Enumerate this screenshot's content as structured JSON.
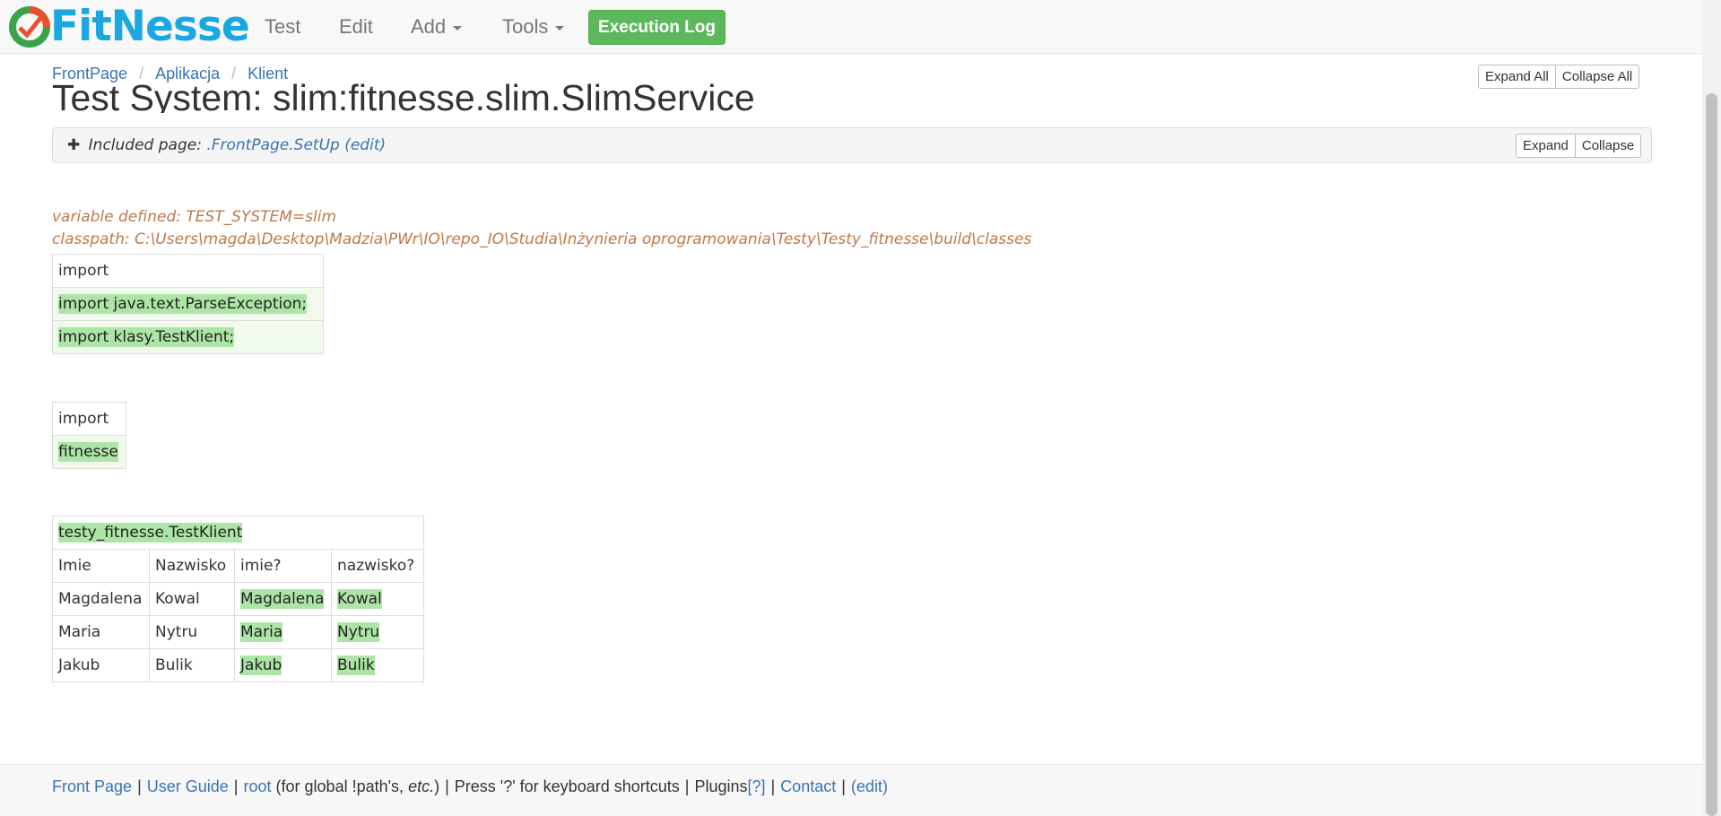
{
  "brand": {
    "name": "FitNesse",
    "color": "#1ba7e0"
  },
  "nav": {
    "test": "Test",
    "edit": "Edit",
    "add": "Add",
    "tools": "Tools",
    "execution_log": "Execution Log"
  },
  "breadcrumb": [
    "FrontPage",
    "Aplikacja",
    "Klient"
  ],
  "title": "Test System: slim:fitnesse.slim.SlimService",
  "page_buttons": {
    "expand_all": "Expand All",
    "collapse_all": "Collapse All"
  },
  "included": {
    "label": "Included page:",
    "page": ".FrontPage.SetUp",
    "edit": "(edit)",
    "expand": "Expand",
    "collapse": "Collapse"
  },
  "variable_defined": "variable defined: TEST_SYSTEM=slim",
  "classpath": "classpath: C:\\Users\\magda\\Desktop\\Madzia\\PWr\\IO\\repo_IO\\Studia\\Inżynieria oprogramowania\\Testy\\Testy_fitnesse\\build\\classes",
  "import_table_1": {
    "header": "import",
    "rows": [
      "import java.text.ParseException;",
      "import klasy.TestKlient;"
    ]
  },
  "import_table_2": {
    "header": "import",
    "rows": [
      "fitnesse"
    ]
  },
  "decision_table": {
    "fixture": "testy_fitnesse.TestKlient",
    "columns": [
      "Imie",
      "Nazwisko",
      "imie?",
      "nazwisko?"
    ],
    "rows": [
      [
        "Magdalena",
        "Kowal",
        "Magdalena",
        "Kowal"
      ],
      [
        "Maria",
        "Nytru",
        "Maria",
        "Nytru"
      ],
      [
        "Jakub",
        "Bulik",
        "Jakub",
        "Bulik"
      ]
    ]
  },
  "footer": {
    "front_page": "Front Page",
    "user_guide": "User Guide",
    "root": "root",
    "root_note_a": "(for global !path's,",
    "root_note_etc": "etc.",
    "root_note_b": ")",
    "shortcuts": "Press '?' for keyboard shortcuts",
    "plugins": "Plugins",
    "plugins_help": "[?]",
    "contact": "Contact",
    "edit": "(edit)"
  },
  "colors": {
    "pass": "#ade5a6",
    "accent_link": "#3a73b3",
    "exec_log": "#5cb85c",
    "info": "#c0784a"
  }
}
